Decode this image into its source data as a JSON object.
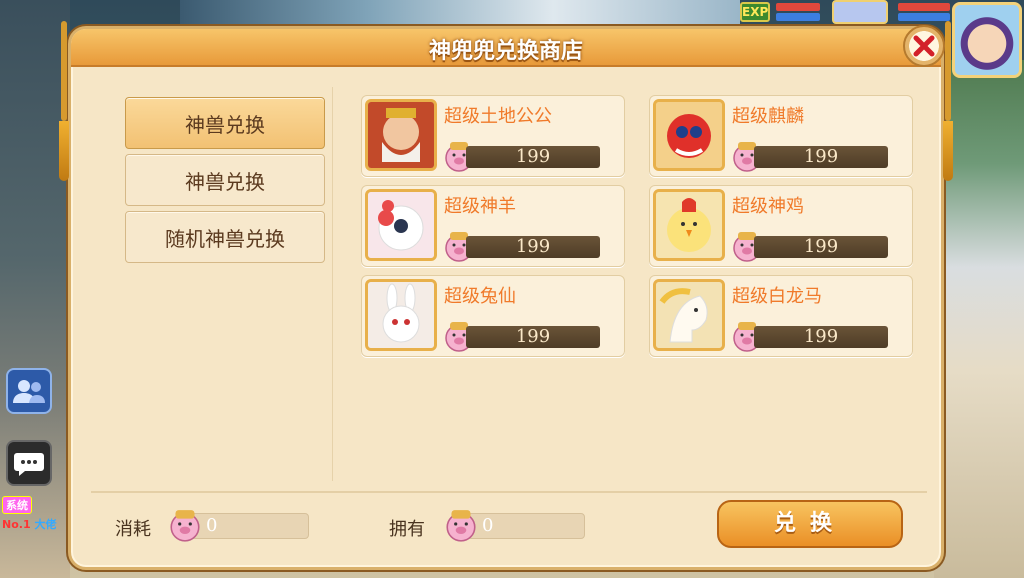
{
  "hud": {
    "exp_label": "EXP",
    "system_tag": "系统",
    "system_msg_prefix": "No.1",
    "system_msg_rest": "大佬"
  },
  "shop": {
    "title": "神兜兜兑换商店",
    "tabs": [
      {
        "label": "神兽兑换",
        "active": true
      },
      {
        "label": "神兽兑换",
        "active": false
      },
      {
        "label": "随机神兽兑换",
        "active": false
      }
    ],
    "items": [
      {
        "name": "超级土地公公",
        "price": "199",
        "icon": "earth-god-portrait"
      },
      {
        "name": "超级麒麟",
        "price": "199",
        "icon": "qilin-portrait"
      },
      {
        "name": "超级神羊",
        "price": "199",
        "icon": "divine-sheep-portrait"
      },
      {
        "name": "超级神鸡",
        "price": "199",
        "icon": "divine-rooster-portrait"
      },
      {
        "name": "超级兔仙",
        "price": "199",
        "icon": "rabbit-immortal-portrait"
      },
      {
        "name": "超级白龙马",
        "price": "199",
        "icon": "white-dragon-horse-portrait"
      }
    ],
    "footer": {
      "cost_label": "消耗",
      "cost_value": "0",
      "own_label": "拥有",
      "own_value": "0",
      "exchange_label": "兑换"
    }
  },
  "colors": {
    "accent": "#f07a2a",
    "panel_bg": "#f6e6c6",
    "price_bar": "#5a4630"
  }
}
